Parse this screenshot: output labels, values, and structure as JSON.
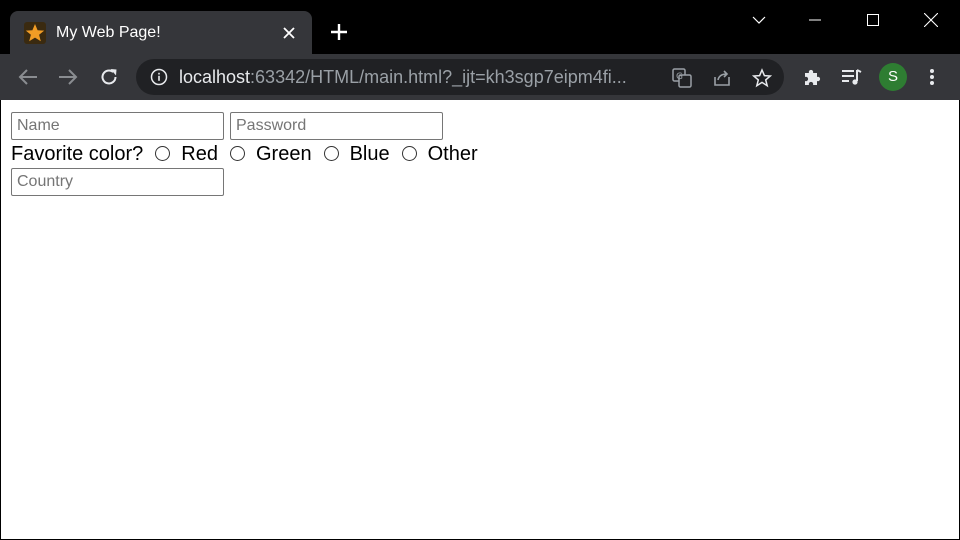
{
  "window": {
    "tab": {
      "title": "My Web Page!",
      "favicon": "star-icon"
    },
    "controls": [
      "chevron-down-icon",
      "minimize-icon",
      "maximize-icon",
      "close-icon"
    ]
  },
  "toolbar": {
    "url_host": "localhost",
    "url_rest": ":63342/HTML/main.html?_ijt=kh3sgp7eipm4fi...",
    "profile_initial": "S"
  },
  "form": {
    "name_placeholder": "Name",
    "password_placeholder": "Password",
    "favorite_color_label": "Favorite color?",
    "color_options": [
      "Red",
      "Green",
      "Blue",
      "Other"
    ],
    "country_placeholder": "Country"
  },
  "colors": {
    "tab_bg": "#35363a",
    "frame_bg": "#000000",
    "favicon_star": "#f29d25",
    "avatar": "#2e7d32"
  }
}
